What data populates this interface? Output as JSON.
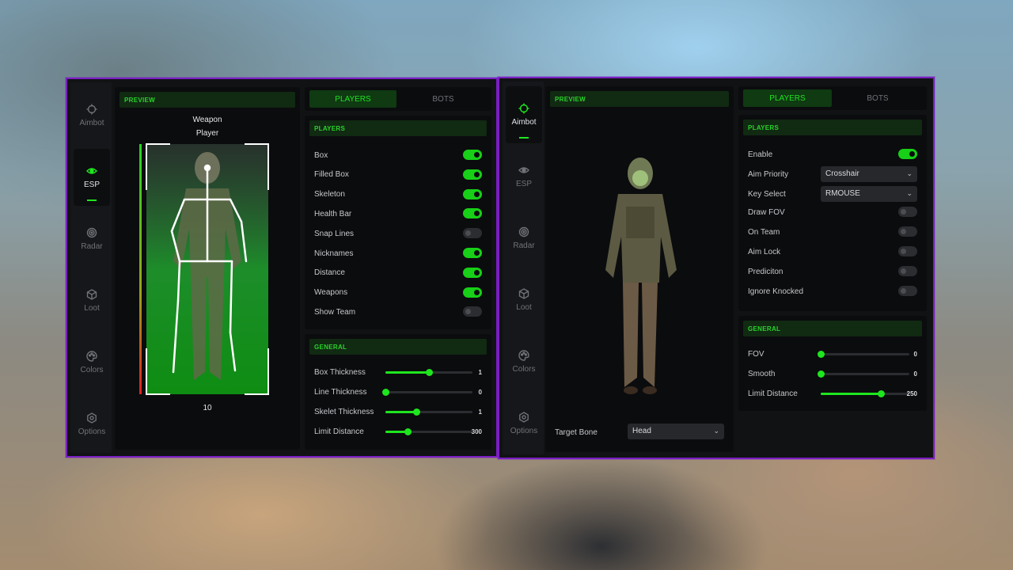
{
  "colors": {
    "accent": "#1ee61e",
    "border": "#7a1fc2",
    "panel": "#0b0c0e"
  },
  "left": {
    "sidebar": [
      {
        "label": "Aimbot",
        "icon": "crosshair-icon",
        "active": false
      },
      {
        "label": "ESP",
        "icon": "eye-icon",
        "active": true
      },
      {
        "label": "Radar",
        "icon": "radar-icon",
        "active": false
      },
      {
        "label": "Loot",
        "icon": "box-icon",
        "active": false
      },
      {
        "label": "Colors",
        "icon": "palette-icon",
        "active": false
      },
      {
        "label": "Options",
        "icon": "gear-icon",
        "active": false
      }
    ],
    "preview": {
      "header": "PREVIEW",
      "weapon_label": "Weapon",
      "name_label": "Player",
      "distance_label": "10"
    },
    "tabs": {
      "players": "PLAYERS",
      "bots": "BOTS"
    },
    "players": {
      "header": "PLAYERS",
      "items": [
        {
          "label": "Box",
          "on": true
        },
        {
          "label": "Filled Box",
          "on": true
        },
        {
          "label": "Skeleton",
          "on": true
        },
        {
          "label": "Health Bar",
          "on": true
        },
        {
          "label": "Snap Lines",
          "on": false
        },
        {
          "label": "Nicknames",
          "on": true
        },
        {
          "label": "Distance",
          "on": true
        },
        {
          "label": "Weapons",
          "on": true
        },
        {
          "label": "Show Team",
          "on": false
        }
      ]
    },
    "general": {
      "header": "GENERAL",
      "sliders": [
        {
          "label": "Box Thickness",
          "value": "1",
          "fraction": 0.5
        },
        {
          "label": "Line Thickness",
          "value": "0",
          "fraction": 0.0
        },
        {
          "label": "Skelet Thickness",
          "value": "1",
          "fraction": 0.35
        },
        {
          "label": "Limit Distance",
          "value": "300",
          "fraction": 0.25
        }
      ]
    }
  },
  "right": {
    "sidebar": [
      {
        "label": "Aimbot",
        "icon": "crosshair-icon",
        "active": true
      },
      {
        "label": "ESP",
        "icon": "eye-icon",
        "active": false
      },
      {
        "label": "Radar",
        "icon": "radar-icon",
        "active": false
      },
      {
        "label": "Loot",
        "icon": "box-icon",
        "active": false
      },
      {
        "label": "Colors",
        "icon": "palette-icon",
        "active": false
      },
      {
        "label": "Options",
        "icon": "gear-icon",
        "active": false
      }
    ],
    "preview": {
      "header": "PREVIEW",
      "target_bone_label": "Target Bone",
      "target_bone_value": "Head"
    },
    "tabs": {
      "players": "PLAYERS",
      "bots": "BOTS"
    },
    "players": {
      "header": "PLAYERS",
      "enable": {
        "label": "Enable",
        "on": true
      },
      "aim_priority": {
        "label": "Aim Priority",
        "value": "Crosshair"
      },
      "key_select": {
        "label": "Key Select",
        "value": "RMOUSE"
      },
      "toggles": [
        {
          "label": "Draw FOV",
          "on": false
        },
        {
          "label": "On Team",
          "on": false
        },
        {
          "label": "Aim Lock",
          "on": false
        },
        {
          "label": "Prediciton",
          "on": false
        },
        {
          "label": "Ignore Knocked",
          "on": false
        }
      ]
    },
    "general": {
      "header": "GENERAL",
      "sliders": [
        {
          "label": "FOV",
          "value": "0",
          "fraction": 0.0
        },
        {
          "label": "Smooth",
          "value": "0",
          "fraction": 0.0
        },
        {
          "label": "Limit Distance",
          "value": "250",
          "fraction": 0.68
        }
      ]
    }
  }
}
